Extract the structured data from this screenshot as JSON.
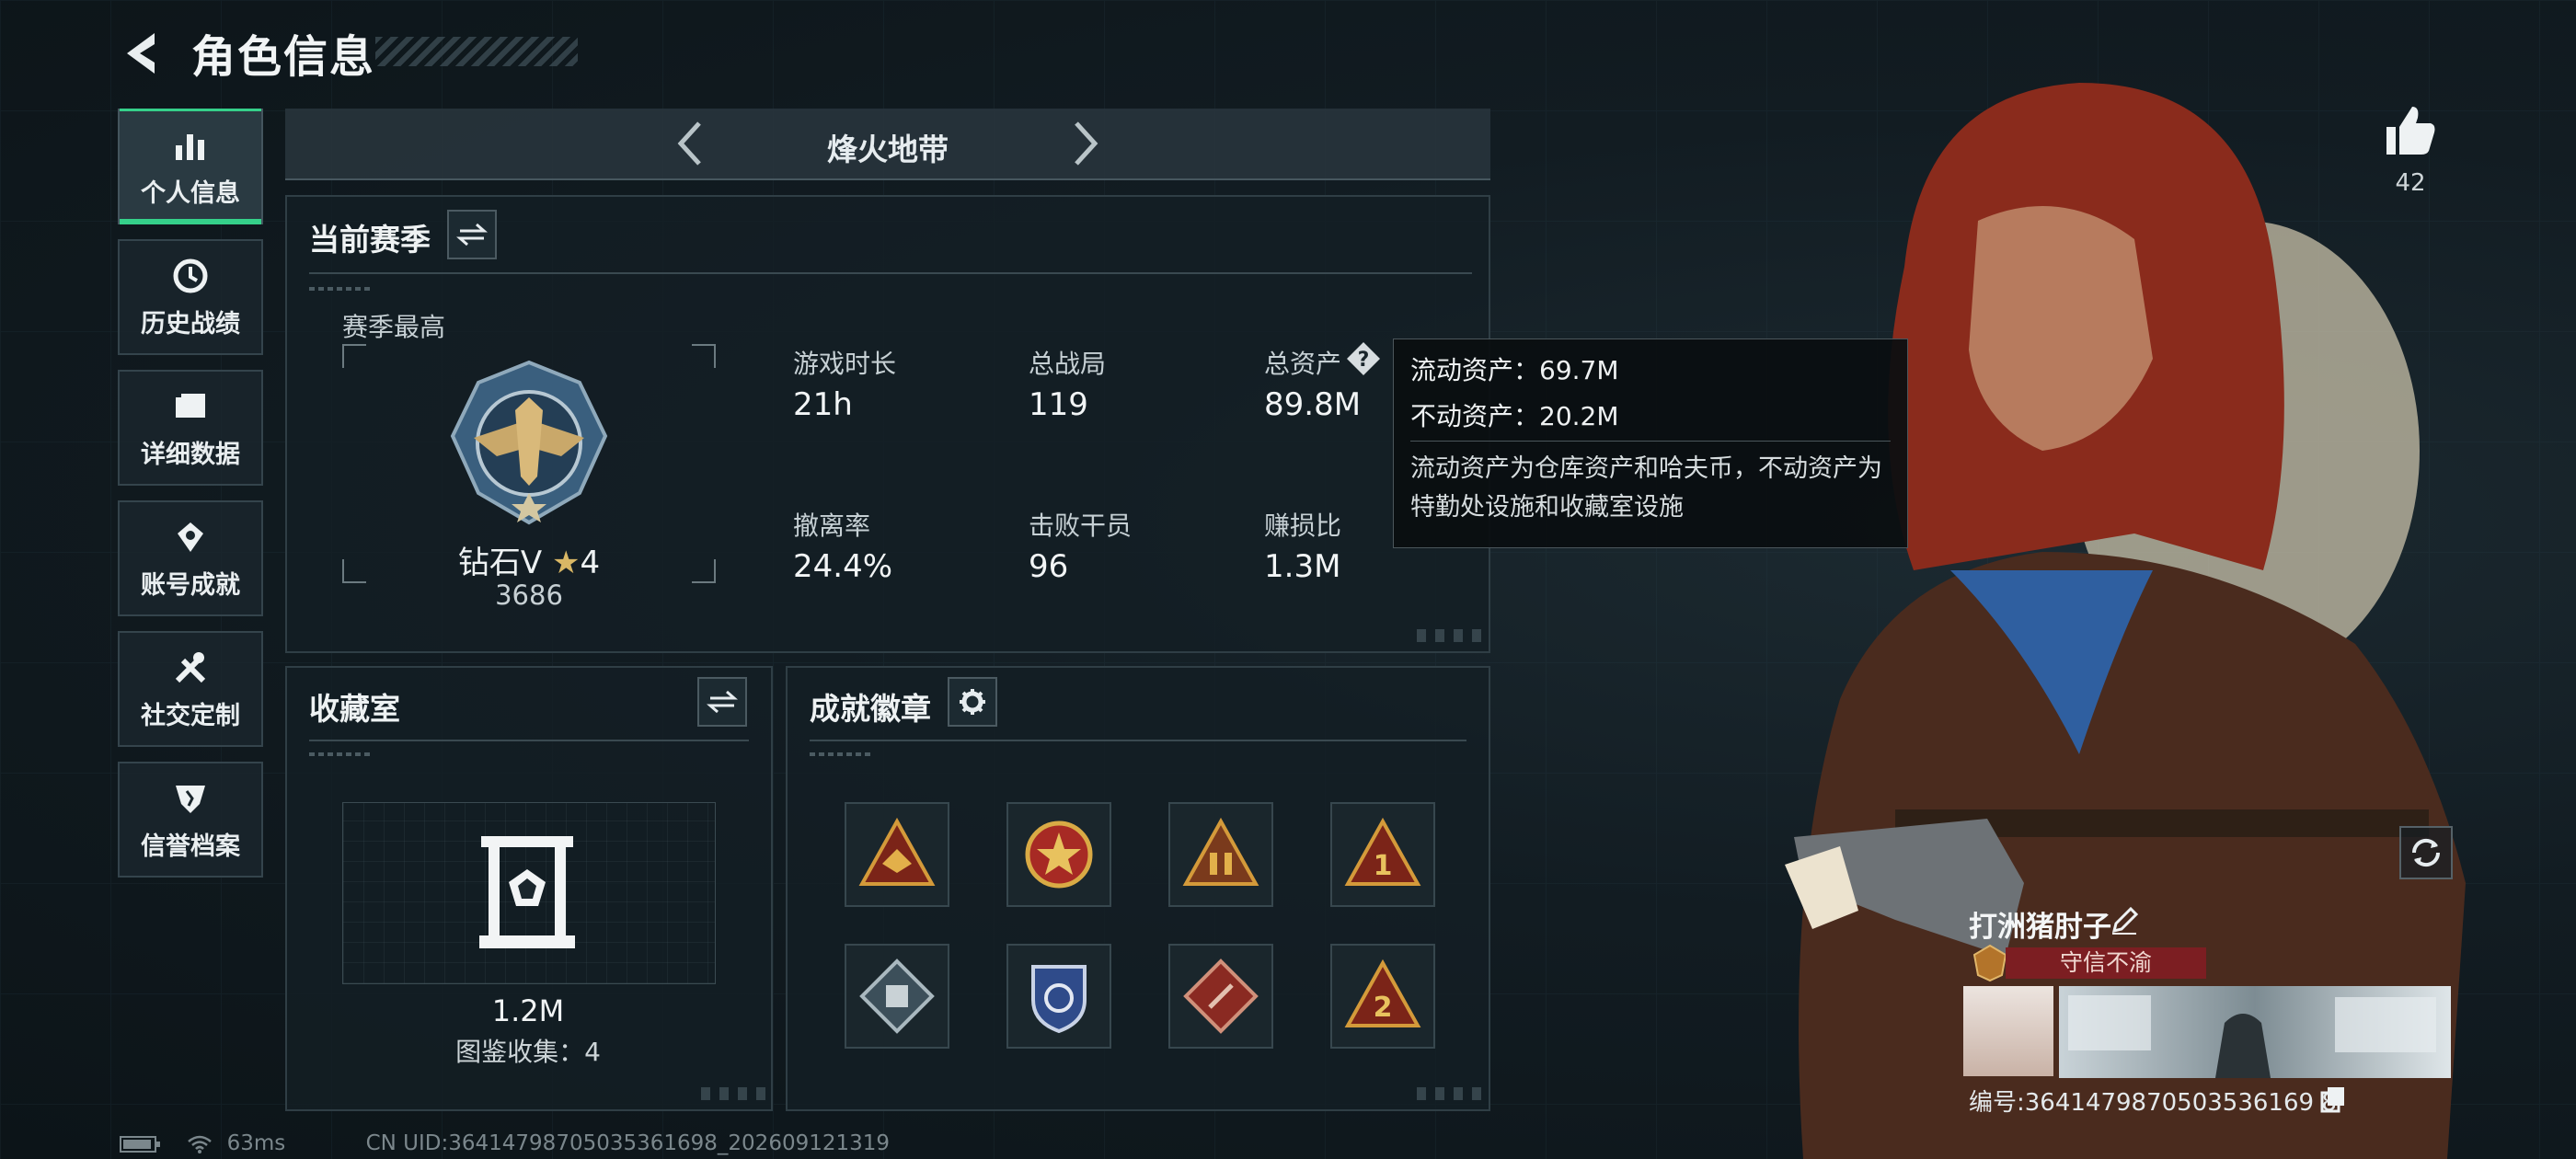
{
  "header": {
    "title": "角色信息"
  },
  "nav": {
    "items": [
      {
        "label": "个人信息",
        "icon": "bar-chart-icon",
        "active": true
      },
      {
        "label": "历史战绩",
        "icon": "clock-icon",
        "active": false
      },
      {
        "label": "详细数据",
        "icon": "folder-icon",
        "active": false
      },
      {
        "label": "账号成就",
        "icon": "achievement-icon",
        "active": false
      },
      {
        "label": "社交定制",
        "icon": "tools-icon",
        "active": false
      },
      {
        "label": "信誉档案",
        "icon": "credit-shield-icon",
        "active": false
      }
    ]
  },
  "mode": {
    "title": "烽火地带"
  },
  "season": {
    "title": "当前赛季",
    "best_label": "赛季最高",
    "rank_name": "钻石V",
    "rank_stars": "4",
    "rank_points": "3686",
    "stats": [
      {
        "label": "游戏时长",
        "value": "21h"
      },
      {
        "label": "总战局",
        "value": "119"
      },
      {
        "label": "总资产",
        "value": "89.8M"
      },
      {
        "label": "撤离率",
        "value": "24.4%"
      },
      {
        "label": "击败干员",
        "value": "96"
      },
      {
        "label": "赚损比",
        "value": "1.3M"
      }
    ]
  },
  "tooltip": {
    "liquid": "流动资产：69.7M",
    "fixed": "不动资产：20.2M",
    "desc": "流动资产为仓库资产和哈夫币，不动资产为特勤处设施和收藏室设施"
  },
  "collection": {
    "title": "收藏室",
    "value": "1.2M",
    "catalog": "图鉴收集：4"
  },
  "badges": {
    "title": "成就徽章",
    "items": [
      "badge-triangle-eagle",
      "badge-star-medal",
      "badge-triangle-soldiers",
      "badge-triangle-1",
      "badge-diamond-crate",
      "badge-shield-police",
      "badge-diamond-red",
      "badge-triangle-2"
    ]
  },
  "profile": {
    "likes": "42",
    "name": "打洲猪肘子",
    "honor_title": "守信不渝",
    "uid_line": "编号:3641479870503536169 8"
  },
  "status": {
    "ping": "63ms",
    "uid": "CN UID:36414798705035361698_202609121319"
  },
  "colors": {
    "accent": "#35d08a",
    "banner": "#7c1e22",
    "bg": "#101a20"
  }
}
